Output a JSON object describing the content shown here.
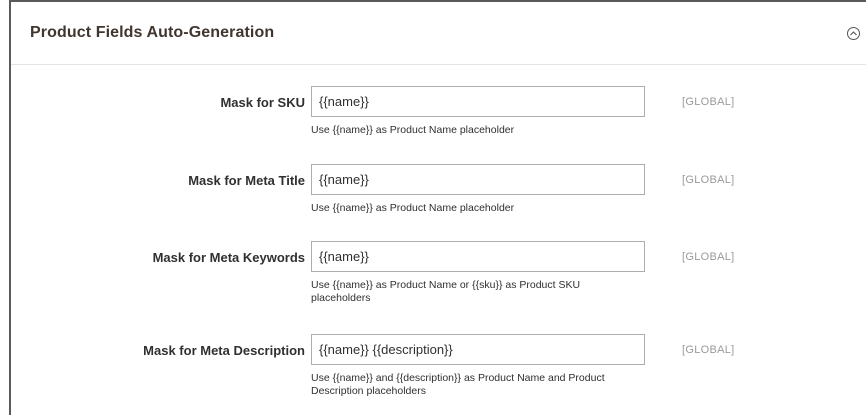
{
  "section": {
    "title": "Product Fields Auto-Generation",
    "collapse_icon": "chevron-up-circle-icon"
  },
  "fields": [
    {
      "label": "Mask for SKU",
      "value": "{{name}}",
      "note": "Use {{name}} as Product Name placeholder",
      "scope": "[GLOBAL]"
    },
    {
      "label": "Mask for Meta Title",
      "value": "{{name}}",
      "note": "Use {{name}} as Product Name placeholder",
      "scope": "[GLOBAL]"
    },
    {
      "label": "Mask for Meta Keywords",
      "value": "{{name}}",
      "note": "Use {{name}} as Product Name or {{sku}} as Product SKU placeholders",
      "scope": "[GLOBAL]"
    },
    {
      "label": "Mask for Meta Description",
      "value": "{{name}} {{description}}",
      "note": "Use {{name}} and {{description}} as Product Name and Product Description placeholders",
      "scope": "[GLOBAL]"
    }
  ]
}
